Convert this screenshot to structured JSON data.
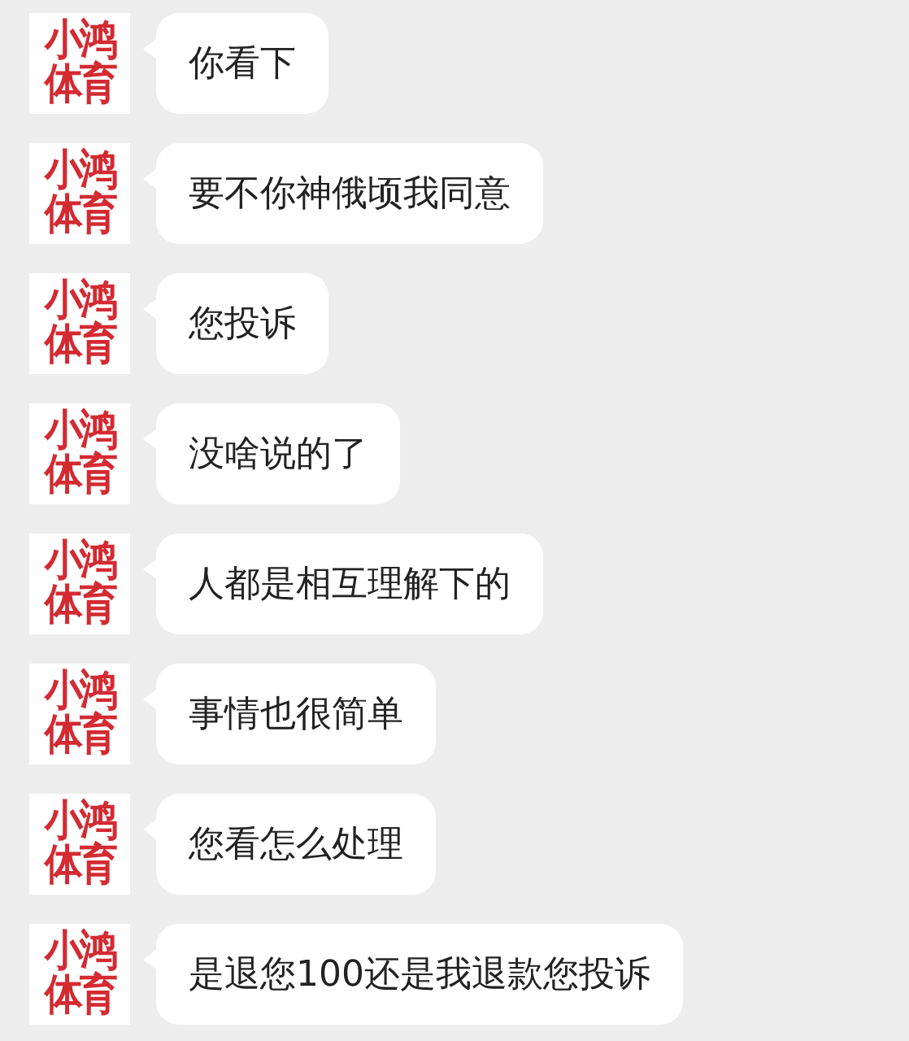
{
  "messages": [
    {
      "avatar": [
        "小鸿",
        "体育"
      ],
      "text": "你看下"
    },
    {
      "avatar": [
        "小鸿",
        "体育"
      ],
      "text": "要不你神俄顷我同意"
    },
    {
      "avatar": [
        "小鸿",
        "体育"
      ],
      "text": "您投诉"
    },
    {
      "avatar": [
        "小鸿",
        "体育"
      ],
      "text": "没啥说的了"
    },
    {
      "avatar": [
        "小鸿",
        "体育"
      ],
      "text": "人都是相互理解下的"
    },
    {
      "avatar": [
        "小鸿",
        "体育"
      ],
      "text": "事情也很简单"
    },
    {
      "avatar": [
        "小鸿",
        "体育"
      ],
      "text": "您看怎么处理"
    },
    {
      "avatar": [
        "小鸿",
        "体育"
      ],
      "text": "是退您100还是我退款您投诉"
    }
  ]
}
